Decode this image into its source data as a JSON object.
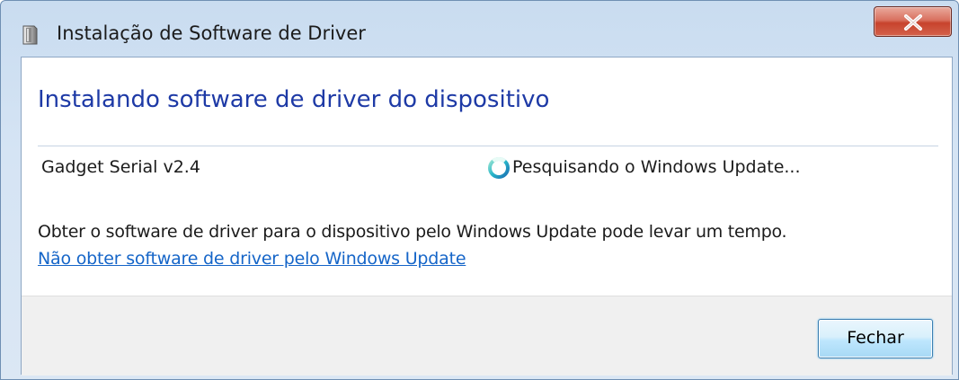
{
  "window": {
    "title": "Instalação de Software de Driver",
    "title_icon": "device-installer-icon",
    "close_icon": "close-x-icon"
  },
  "main": {
    "heading": "Instalando software de driver do dispositivo",
    "device": {
      "name": "Gadget Serial v2.4",
      "status_icon": "searching-spinner-icon",
      "status": "Pesquisando o Windows Update..."
    },
    "info": "Obter o software de driver para o dispositivo pelo Windows Update pode levar um tempo.",
    "skip_link": "Não obter software de driver pelo Windows Update"
  },
  "footer": {
    "close_label": "Fechar"
  },
  "colors": {
    "heading": "#1e3aa6",
    "link": "#1565c8",
    "close_button_red": "#c7432d"
  }
}
